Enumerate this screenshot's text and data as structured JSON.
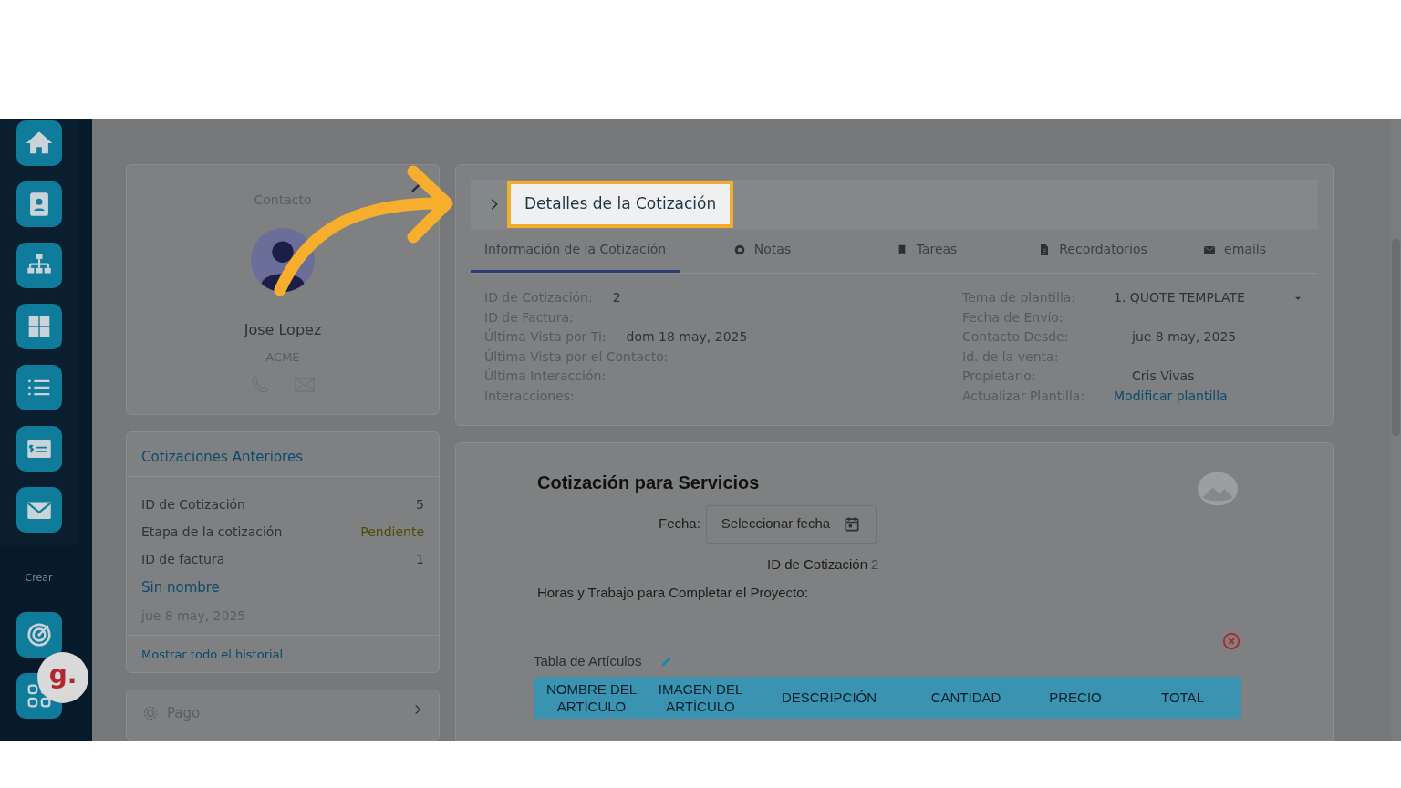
{
  "sidebar": {
    "section_label": "Crear"
  },
  "floating_badge": {
    "label": "g."
  },
  "contact_card": {
    "title": "Contacto",
    "name": "Jose Lopez",
    "company": "ACME"
  },
  "previous_quotes": {
    "title": "Cotizaciones Anteriores",
    "rows": [
      {
        "label": "ID de Cotización",
        "value": "5",
        "kind": "plain"
      },
      {
        "label": "Etapa de la cotización",
        "value": "Pendiente",
        "kind": "status"
      },
      {
        "label": "ID de factura",
        "value": "1",
        "kind": "plain"
      }
    ],
    "quote_name": "Sin nombre",
    "quote_date": "jue 8 may, 2025",
    "footer_link": "Mostrar todo el historial"
  },
  "payment_card": {
    "title": "Pago"
  },
  "quote_details": {
    "title": "Detalles de la Cotización",
    "highlighted": true,
    "tabs": [
      {
        "label": "Información de la Cotización",
        "selected": true,
        "kind": "info"
      },
      {
        "label": "Notas",
        "selected": false,
        "kind": "notes"
      },
      {
        "label": "Tareas",
        "selected": false,
        "kind": "tasks"
      },
      {
        "label": "Recordatorios",
        "selected": false,
        "kind": "reminders"
      },
      {
        "label": "emails",
        "selected": false,
        "kind": "emails"
      }
    ],
    "left_fields": [
      {
        "label": "ID de Cotización:",
        "value": "2"
      },
      {
        "label": "ID de Factura:"
      },
      {
        "label": "Última Vista por Ti:",
        "value": "dom 18 may, 2025"
      },
      {
        "label": "Última Vista por el Contacto:"
      },
      {
        "label": "Última Interacción:"
      },
      {
        "label": "Interacciones:"
      }
    ],
    "right_fields": [
      {
        "label": "Tema de plantilla:",
        "value": "1. QUOTE TEMPLATE",
        "kind": "select"
      },
      {
        "label": "Fecha de Envío:",
        "kind": "text"
      },
      {
        "label": "Contacto Desde:",
        "value": "jue 8 may, 2025",
        "kind": "text"
      },
      {
        "label": "Id. de la venta:",
        "kind": "text"
      },
      {
        "label": "Propietario:",
        "value": "Cris Vivas",
        "kind": "text"
      },
      {
        "label": "Actualizar Plantilla:",
        "value": "Modificar plantilla",
        "kind": "link"
      }
    ]
  },
  "document": {
    "title": "Cotización para Servicios",
    "date_label": "Fecha:",
    "date_placeholder": "Seleccionar fecha",
    "quote_id_label": "ID de Cotización",
    "quote_id_value": "2",
    "description": "Horas y Trabajo para Completar el Proyecto:",
    "table_label": "Tabla de Artículos",
    "table": {
      "columns": [
        "NOMBRE DEL ARTÍCULO",
        "IMAGEN DEL ARTÍCULO",
        "DESCRIPCIÓN",
        "CANTIDAD",
        "PRECIO",
        "TOTAL"
      ]
    }
  }
}
